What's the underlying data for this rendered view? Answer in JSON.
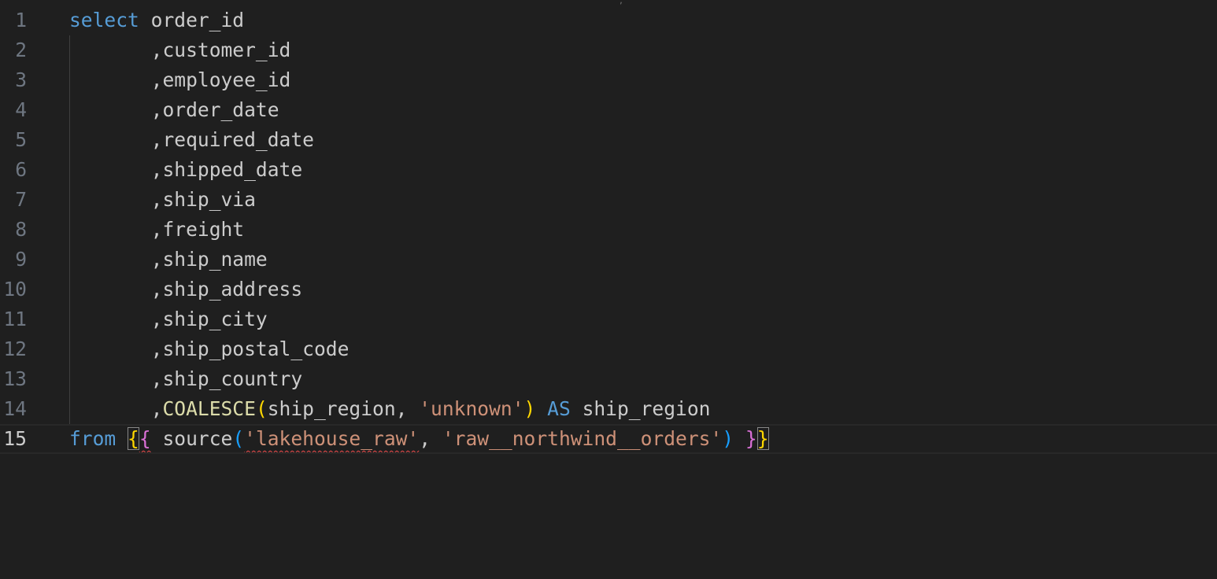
{
  "editor": {
    "language": "sql",
    "active_line": 15,
    "line_numbers": [
      "1",
      "2",
      "3",
      "4",
      "5",
      "6",
      "7",
      "8",
      "9",
      "10",
      "11",
      "12",
      "13",
      "14",
      "15"
    ],
    "lines": {
      "l1": {
        "kw": "select",
        "rest": " order_id"
      },
      "l2": {
        "indent": "       ",
        "text": ",customer_id"
      },
      "l3": {
        "indent": "       ",
        "text": ",employee_id"
      },
      "l4": {
        "indent": "       ",
        "text": ",order_date"
      },
      "l5": {
        "indent": "       ",
        "text": ",required_date"
      },
      "l6": {
        "indent": "       ",
        "text": ",shipped_date"
      },
      "l7": {
        "indent": "       ",
        "text": ",ship_via"
      },
      "l8": {
        "indent": "       ",
        "text": ",freight"
      },
      "l9": {
        "indent": "       ",
        "text": ",ship_name"
      },
      "l10": {
        "indent": "       ",
        "text": ",ship_address"
      },
      "l11": {
        "indent": "       ",
        "text": ",ship_city"
      },
      "l12": {
        "indent": "       ",
        "text": ",ship_postal_code"
      },
      "l13": {
        "indent": "       ",
        "text": ",ship_country"
      },
      "l14": {
        "indent": "       ",
        "comma": ",",
        "fn": "COALESCE",
        "open": "(",
        "arg1": "ship_region, ",
        "str": "'unknown'",
        "close": ")",
        "sp1": " ",
        "kw": "AS",
        "alias": " ship_region"
      },
      "l15": {
        "kw": "from",
        "sp0": " ",
        "b1": "{",
        "b2": "{",
        "sp1": " ",
        "fn": "source",
        "open": "(",
        "str1": "'lakehouse_raw'",
        "comma": ", ",
        "str2": "'raw__northwind__orders'",
        "close": ")",
        "sp2": " ",
        "b3": "}",
        "b4": "}"
      }
    },
    "colors": {
      "background": "#1f1f1f",
      "keyword": "#569cd6",
      "function": "#dcdcaa",
      "string": "#ce9178",
      "error_squiggle": "#f14c4c"
    }
  }
}
